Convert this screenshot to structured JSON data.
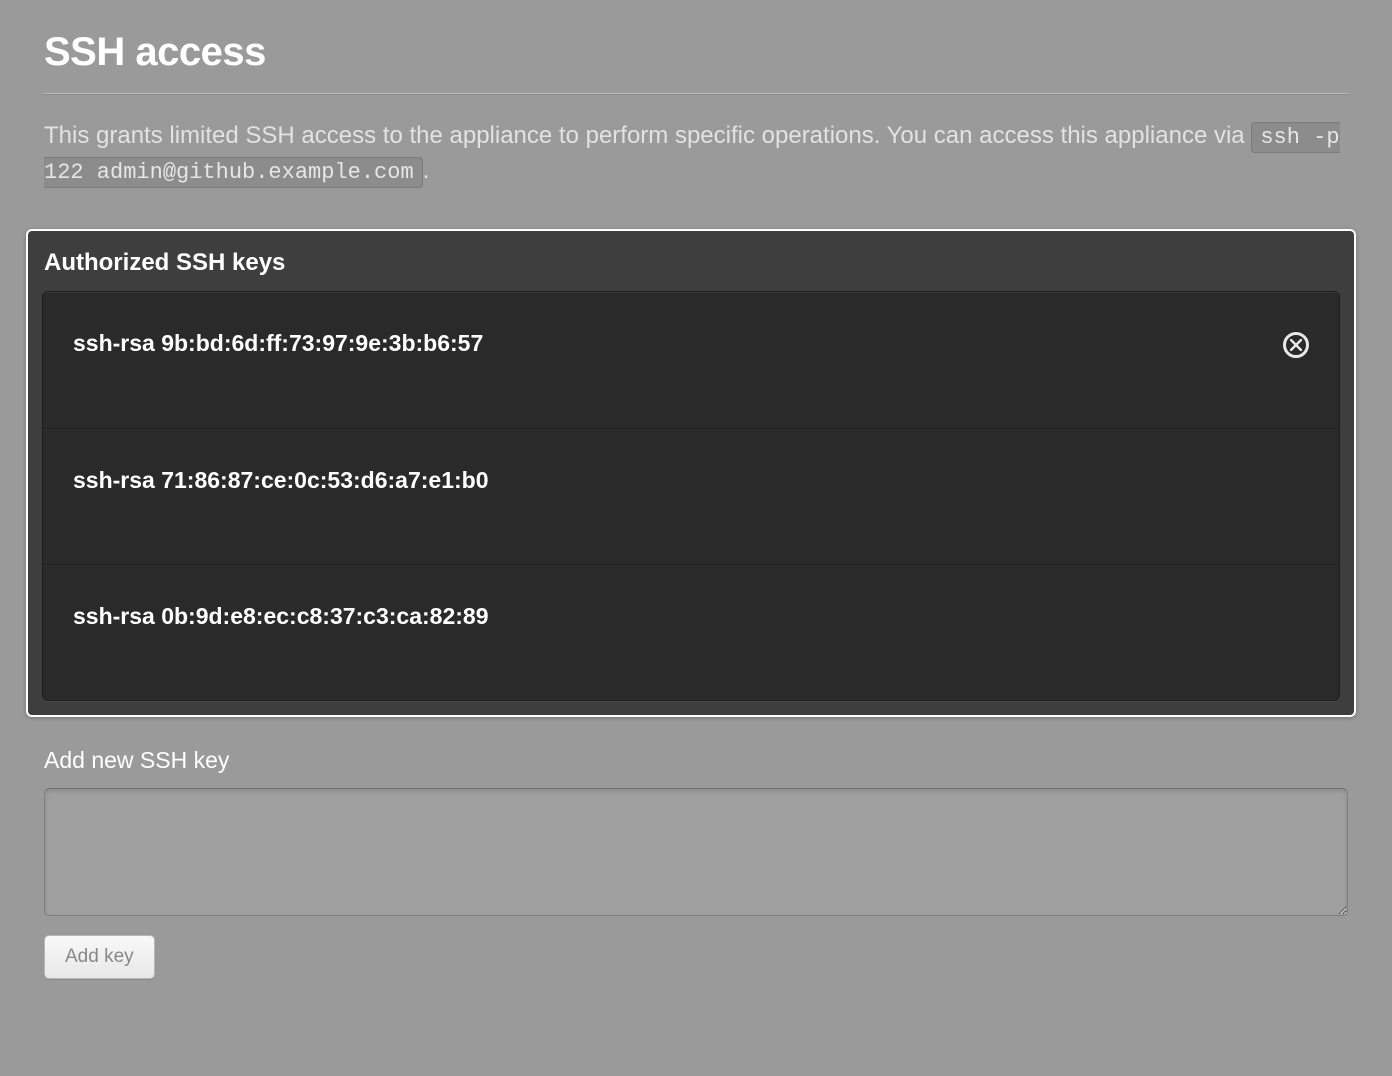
{
  "page": {
    "title": "SSH access",
    "description_prefix": "This grants limited SSH access to the appliance to perform specific operations. You can access this appliance via ",
    "ssh_command": "ssh -p 122 admin@github.example.com",
    "description_suffix": "."
  },
  "panel": {
    "title": "Authorized SSH keys",
    "keys": [
      {
        "label": "ssh-rsa 9b:bd:6d:ff:73:97:9e:3b:b6:57",
        "show_remove": true
      },
      {
        "label": "ssh-rsa 71:86:87:ce:0c:53:d6:a7:e1:b0",
        "show_remove": false
      },
      {
        "label": "ssh-rsa 0b:9d:e8:ec:c8:37:c3:ca:82:89",
        "show_remove": false
      }
    ]
  },
  "add": {
    "label": "Add new SSH key",
    "textarea_value": "",
    "button_label": "Add key"
  }
}
